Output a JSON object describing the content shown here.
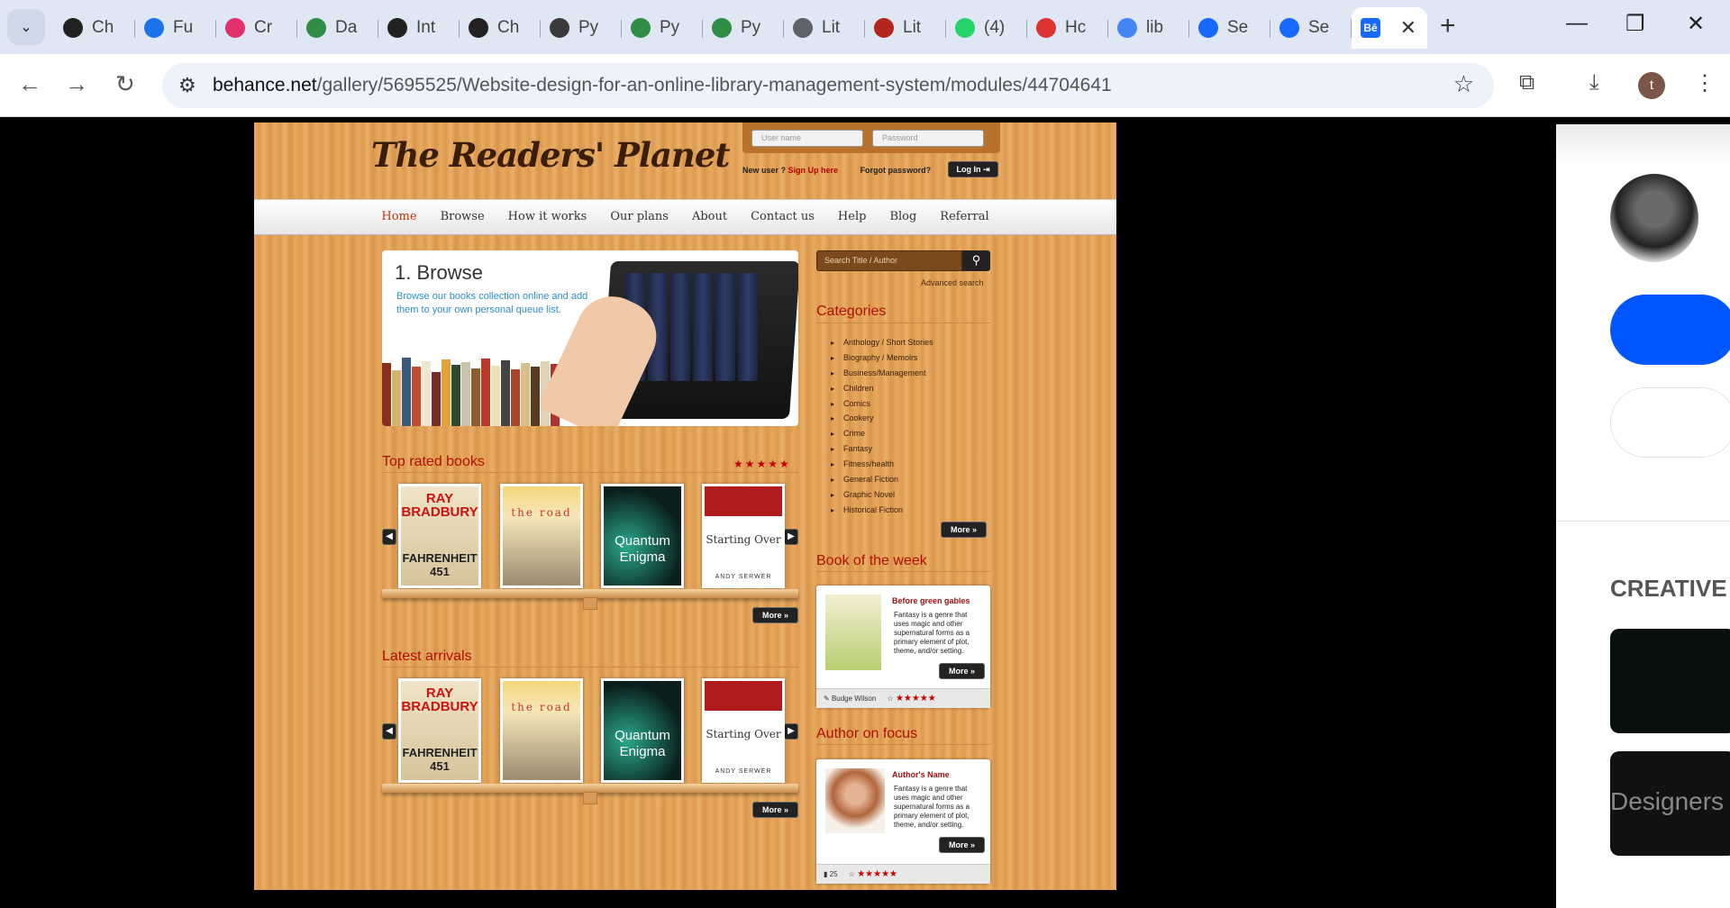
{
  "browser": {
    "tabs": [
      {
        "label": "Ch",
        "icon": "openai-icon",
        "color": "#222222"
      },
      {
        "label": "Fu",
        "icon": "k-icon",
        "color": "#1a73e8"
      },
      {
        "label": "Cr",
        "icon": "instagram-icon",
        "color": "#e1306c"
      },
      {
        "label": "Da",
        "icon": "geeksforgeeks-icon",
        "color": "#2f8d46"
      },
      {
        "label": "Int",
        "icon": "openai-icon",
        "color": "#222222"
      },
      {
        "label": "Ch",
        "icon": "openai-icon",
        "color": "#222222"
      },
      {
        "label": "Py",
        "icon": "python-icon",
        "color": "#3a3a3a"
      },
      {
        "label": "Py",
        "icon": "geeksforgeeks-icon",
        "color": "#2f8d46"
      },
      {
        "label": "Py",
        "icon": "geeksforgeeks-icon",
        "color": "#2f8d46"
      },
      {
        "label": "Lit",
        "icon": "globe-icon",
        "color": "#5f6368"
      },
      {
        "label": "Lit",
        "icon": "robot-icon",
        "color": "#b3261e"
      },
      {
        "label": "(4)",
        "icon": "whatsapp-icon",
        "color": "#25d366"
      },
      {
        "label": "Hc",
        "icon": "flower-icon",
        "color": "#d33"
      },
      {
        "label": "lib",
        "icon": "google-icon",
        "color": "#4285f4"
      },
      {
        "label": "Se",
        "icon": "behance-icon",
        "color": "#1769ff"
      },
      {
        "label": "Se",
        "icon": "behance-icon",
        "color": "#1769ff"
      }
    ],
    "active_tab_icon": "Bē",
    "url_domain": "behance.net",
    "url_path": "/gallery/5695525/Website-design-for-an-online-library-management-system/modules/44704641",
    "profile_initial": "t"
  },
  "site": {
    "logo": "The Readers' Planet",
    "login": {
      "username_placeholder": "User name",
      "password_placeholder": "Password",
      "new_user": "New user ?",
      "sign_up": "Sign Up here",
      "forgot": "Forgot password?",
      "login_button": "Log In"
    },
    "nav": [
      "Home",
      "Browse",
      "How it works",
      "Our plans",
      "About",
      "Contact us",
      "Help",
      "Blog",
      "Referral"
    ],
    "hero": {
      "title": "1. Browse",
      "subtitle": "Browse our books collection online and add them to your own personal queue list."
    },
    "top_rated_title": "Top rated books",
    "latest_title": "Latest arrivals",
    "stars": "★★★★★",
    "more_label": "More",
    "books": [
      {
        "line1": "RAY BRADBURY",
        "line2": "FAHRENHEIT 451"
      },
      {
        "line1": "the road",
        "line2": ""
      },
      {
        "line1": "Quantum Enigma",
        "line2": ""
      },
      {
        "line1": "Starting Over",
        "line2": "ANDY SERWER"
      }
    ],
    "search_placeholder": "Search Title / Author",
    "advanced_search": "Advanced search",
    "categories_title": "Categories",
    "categories": [
      "Anthology / Short Stories",
      "Biography / Memoirs",
      "Business/Management",
      "Children",
      "Comics",
      "Cookery",
      "Crime",
      "Fantasy",
      "Fitness/health",
      "General Fiction",
      "Graphic Novel",
      "Historical Fiction"
    ],
    "book_of_week_title": "Book of the week",
    "book_of_week": {
      "title": "Before green gables",
      "text": "Fantasy is a genre that uses magic and other supernatural forms as a primary element of plot, theme, and/or setting.",
      "author": "Budge Wilson"
    },
    "author_focus_title": "Author on focus",
    "author_focus": {
      "name": "Author's Name",
      "text": "Fantasy is a genre that uses magic and other supernatural forms as a primary element of plot, theme, and/or setting.",
      "count": "25"
    }
  },
  "sidebar_right": {
    "heading": "CREATIVE",
    "thumb_text": "Designers"
  }
}
